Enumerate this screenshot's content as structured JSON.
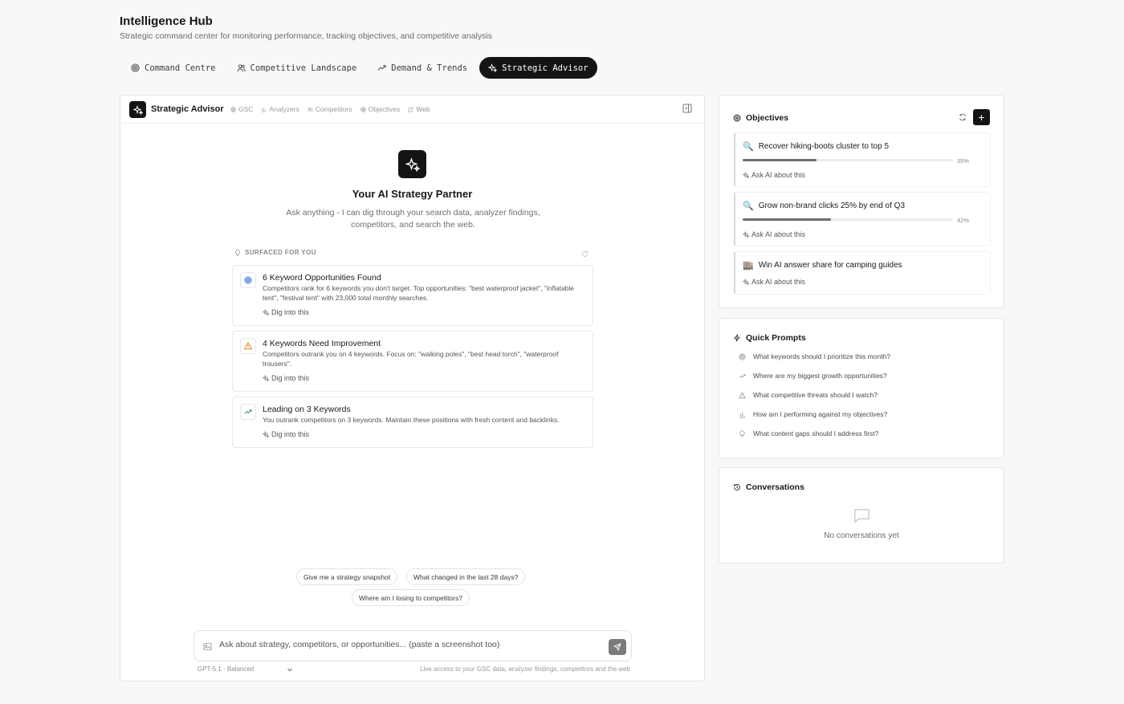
{
  "header": {
    "title": "Intelligence Hub",
    "subtitle": "Strategic command center for monitoring performance, tracking objectives, and competitive analysis"
  },
  "tabs": [
    {
      "label": "Command Centre",
      "icon": "target-icon",
      "active": false
    },
    {
      "label": "Competitive Landscape",
      "icon": "users-icon",
      "active": false
    },
    {
      "label": "Demand & Trends",
      "icon": "trending-up-icon",
      "active": false
    },
    {
      "label": "Strategic Advisor",
      "icon": "sparkles-icon",
      "active": true
    }
  ],
  "advisor": {
    "title": "Strategic Advisor",
    "sources": [
      "GSC",
      "Analyzers",
      "Competitors",
      "Objectives",
      "Web"
    ],
    "hero_title": "Your AI Strategy Partner",
    "hero_subtitle": "Ask anything - I can dig through your search data, analyzer findings, competitors, and search the web.",
    "surfaced_label": "SURFACED FOR YOU",
    "insights": [
      {
        "title": "6 Keyword Opportunities Found",
        "description": "Competitors rank for 6 keywords you don't target. Top opportunities: \"best waterproof jacket\", \"inflatable tent\", \"festival tent\" with 23,000 total monthly searches.",
        "action": "Dig into this",
        "icon": "target-icon",
        "color": "#3b6fd8"
      },
      {
        "title": "4 Keywords Need Improvement",
        "description": "Competitors outrank you on 4 keywords. Focus on: \"walking poles\", \"best head torch\", \"waterproof trousers\".",
        "action": "Dig into this",
        "icon": "warning-icon",
        "color": "#d98a1c"
      },
      {
        "title": "Leading on 3 Keywords",
        "description": "You outrank competitors on 3 keywords. Maintain these positions with fresh content and backlinks.",
        "action": "Dig into this",
        "icon": "trending-up-icon",
        "color": "#2e9a5a"
      }
    ],
    "suggestions": [
      "Give me a strategy snapshot",
      "What changed in the last 28 days?",
      "Where am I losing to competitors?"
    ],
    "input_placeholder": "Ask about strategy, competitors, or opportunities... (paste a screenshot too)",
    "model_label": "GPT-5.1 · Balanced",
    "access_note": "Live access to your GSC data, analyzer findings, competitors and the web"
  },
  "objectives": {
    "title": "Objectives",
    "add_label": "+",
    "items": [
      {
        "emoji": "🔍",
        "title": "Recover hiking-boots cluster to top 5",
        "progress": 35,
        "progress_label": "35%",
        "ask": "Ask AI about this"
      },
      {
        "emoji": "🔍",
        "title": "Grow non-brand clicks 25% by end of Q3",
        "progress": 42,
        "progress_label": "42%",
        "ask": "Ask AI about this"
      },
      {
        "emoji": "🏬",
        "title": "Win AI answer share for camping guides",
        "progress": null,
        "ask": "Ask AI about this"
      }
    ]
  },
  "quick_prompts": {
    "title": "Quick Prompts",
    "items": [
      {
        "label": "What keywords should I prioritize this month?",
        "icon": "target-icon"
      },
      {
        "label": "Where are my biggest growth opportunities?",
        "icon": "trending-up-icon"
      },
      {
        "label": "What competitive threats should I watch?",
        "icon": "warning-icon"
      },
      {
        "label": "How am I performing against my objectives?",
        "icon": "bar-chart-icon"
      },
      {
        "label": "What content gaps should I address first?",
        "icon": "lightbulb-icon"
      }
    ]
  },
  "conversations": {
    "title": "Conversations",
    "empty_text": "No conversations yet"
  }
}
